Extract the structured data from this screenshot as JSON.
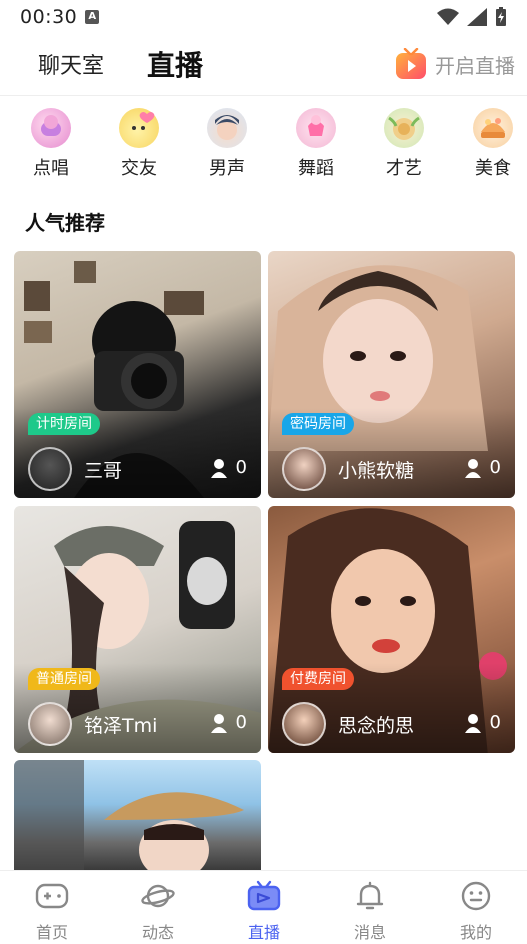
{
  "status_bar": {
    "time": "00:30",
    "keyboard_indicator": "A"
  },
  "header": {
    "tab_chat": "聊天室",
    "tab_live": "直播",
    "start_live_label": "开启直播"
  },
  "categories": [
    {
      "label": "点唱",
      "icon": "microphone-icon"
    },
    {
      "label": "交友",
      "icon": "chick-heart-icon"
    },
    {
      "label": "男声",
      "icon": "male-avatar-icon"
    },
    {
      "label": "舞蹈",
      "icon": "dance-icon"
    },
    {
      "label": "才艺",
      "icon": "talent-icon"
    },
    {
      "label": "美食",
      "icon": "food-icon"
    }
  ],
  "section_title": "人气推荐",
  "rooms": [
    {
      "badge": "计时房间",
      "badge_color": "#1ec98a",
      "name": "三哥",
      "viewers": "0"
    },
    {
      "badge": "密码房间",
      "badge_color": "#19a6e8",
      "name": "小熊软糖",
      "viewers": "0"
    },
    {
      "badge": "普通房间",
      "badge_color": "#f0b81a",
      "name": "铭泽Tmi",
      "viewers": "0"
    },
    {
      "badge": "付费房间",
      "badge_color": "#f0522e",
      "name": "思念的思",
      "viewers": "0"
    }
  ],
  "bottom_nav": [
    {
      "label": "首页",
      "icon": "gamepad-icon"
    },
    {
      "label": "动态",
      "icon": "planet-icon"
    },
    {
      "label": "直播",
      "icon": "tv-icon",
      "active": true
    },
    {
      "label": "消息",
      "icon": "bell-icon"
    },
    {
      "label": "我的",
      "icon": "face-icon"
    }
  ],
  "colors": {
    "accent": "#4b62f0",
    "start_live_icon": "#ff6a3c"
  }
}
